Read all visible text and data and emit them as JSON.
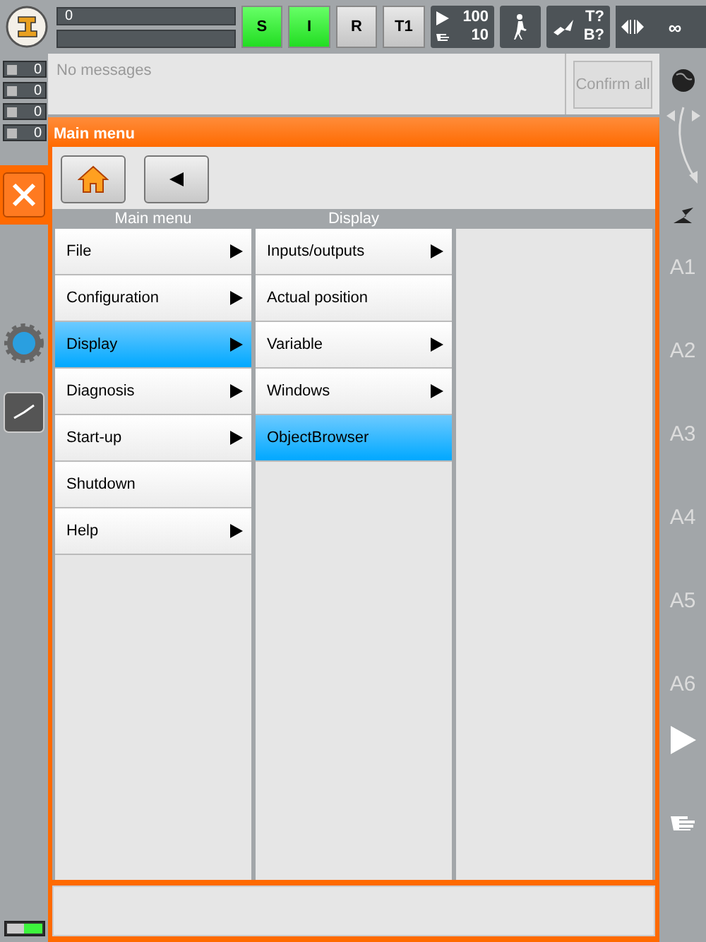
{
  "top_bar": {
    "status_field": "0",
    "mode_buttons": [
      {
        "label": "S",
        "on": true
      },
      {
        "label": "I",
        "on": true
      },
      {
        "label": "R",
        "on": false
      },
      {
        "label": "T1",
        "on": false
      }
    ],
    "override": {
      "program": "100",
      "jog": "10"
    },
    "tool_base": {
      "tool": "T?",
      "base": "B?"
    },
    "increment": "∞"
  },
  "message_counters": [
    "0",
    "0",
    "0",
    "0"
  ],
  "messages": {
    "text": "No messages",
    "confirm_button": {
      "label": "Confirm all",
      "disabled": true
    }
  },
  "main_menu": {
    "title": "Main menu",
    "columns": [
      {
        "heading": "Main menu",
        "items": [
          {
            "label": "File",
            "submenu": true,
            "selected": false
          },
          {
            "label": "Configuration",
            "submenu": true,
            "selected": false
          },
          {
            "label": "Display",
            "submenu": true,
            "selected": true
          },
          {
            "label": "Diagnosis",
            "submenu": true,
            "selected": false
          },
          {
            "label": "Start-up",
            "submenu": true,
            "selected": false
          },
          {
            "label": "Shutdown",
            "submenu": false,
            "selected": false
          },
          {
            "label": "Help",
            "submenu": true,
            "selected": false
          }
        ]
      },
      {
        "heading": "Display",
        "items": [
          {
            "label": "Inputs/outputs",
            "submenu": true,
            "selected": false
          },
          {
            "label": "Actual position",
            "submenu": false,
            "selected": false
          },
          {
            "label": "Variable",
            "submenu": true,
            "selected": false
          },
          {
            "label": "Windows",
            "submenu": true,
            "selected": false
          },
          {
            "label": "ObjectBrowser",
            "submenu": false,
            "selected": true
          }
        ]
      },
      {}
    ]
  },
  "axes": [
    "A1",
    "A2",
    "A3",
    "A4",
    "A5",
    "A6"
  ]
}
